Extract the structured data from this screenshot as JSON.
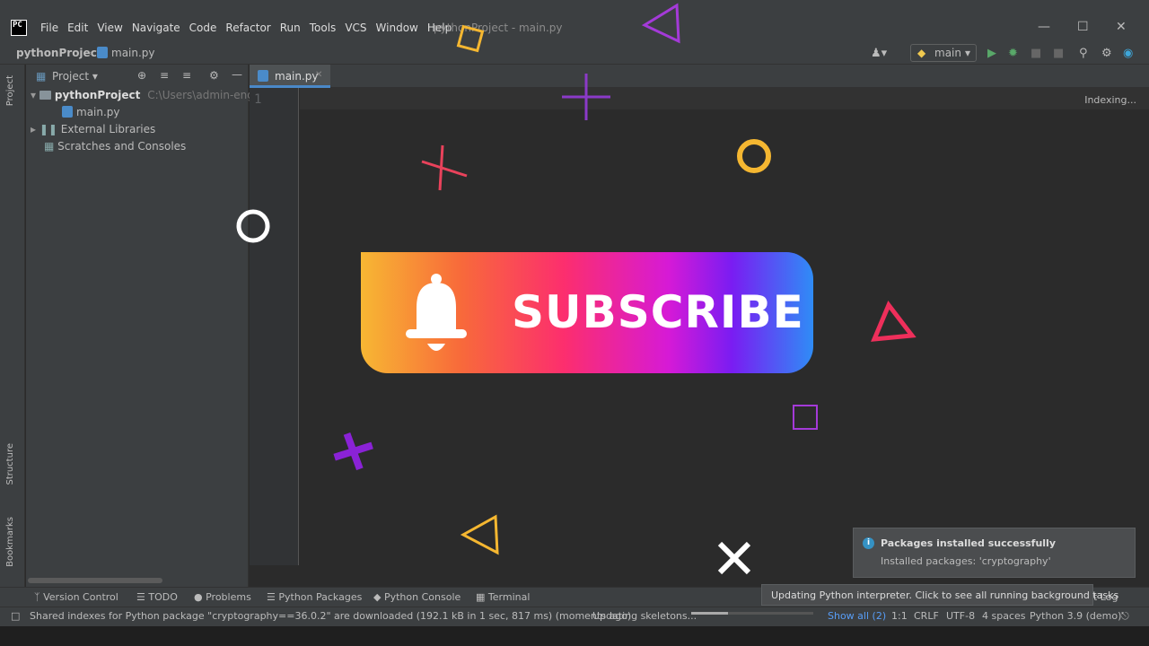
{
  "app": {
    "logo_text": "PC",
    "window_title": "pythonProject - main.py",
    "menu": [
      "File",
      "Edit",
      "View",
      "Navigate",
      "Code",
      "Refactor",
      "Run",
      "Tools",
      "VCS",
      "Window",
      "Help"
    ]
  },
  "breadcrumb": {
    "project": "pythonProject",
    "file": "main.py"
  },
  "run_config": {
    "label": "main"
  },
  "left_stripe": {
    "project_tab": "Project",
    "structure_tab": "Structure",
    "bookmarks_tab": "Bookmarks"
  },
  "project_panel": {
    "title": "Project",
    "tree": [
      {
        "label": "pythonProject",
        "path": "C:\\Users\\admin-engineer\\"
      },
      {
        "label": "main.py"
      },
      {
        "label": "External Libraries"
      },
      {
        "label": "Scratches and Consoles"
      }
    ]
  },
  "editor": {
    "tab_label": "main.py",
    "line_number": "1",
    "indexing": "Indexing..."
  },
  "overlay": {
    "subscribe_text": "SUBSCRIBE"
  },
  "tool_windows": [
    "Version Control",
    "TODO",
    "Problems",
    "Python Packages",
    "Python Console",
    "Terminal",
    "t Log"
  ],
  "notification": {
    "title": "Packages installed successfully",
    "body": "Installed packages: 'cryptography'"
  },
  "tooltip": "Updating Python interpreter. Click to see all running background tasks",
  "status": {
    "message": "Shared indexes for Python package \"cryptography==36.0.2\" are downloaded (192.1 kB in 1 sec, 817 ms) (moments ago)",
    "task": "Updating skeletons...",
    "task_progress": 0.3,
    "show_all": "Show all (2)",
    "position": "1:1",
    "line_sep": "CRLF",
    "encoding": "UTF-8",
    "indent": "4 spaces",
    "interpreter": "Python 3.9 (demo)"
  },
  "colors": {
    "accent": "#4a88c7",
    "background": "#2b2b2b",
    "panel": "#3c3f41"
  }
}
